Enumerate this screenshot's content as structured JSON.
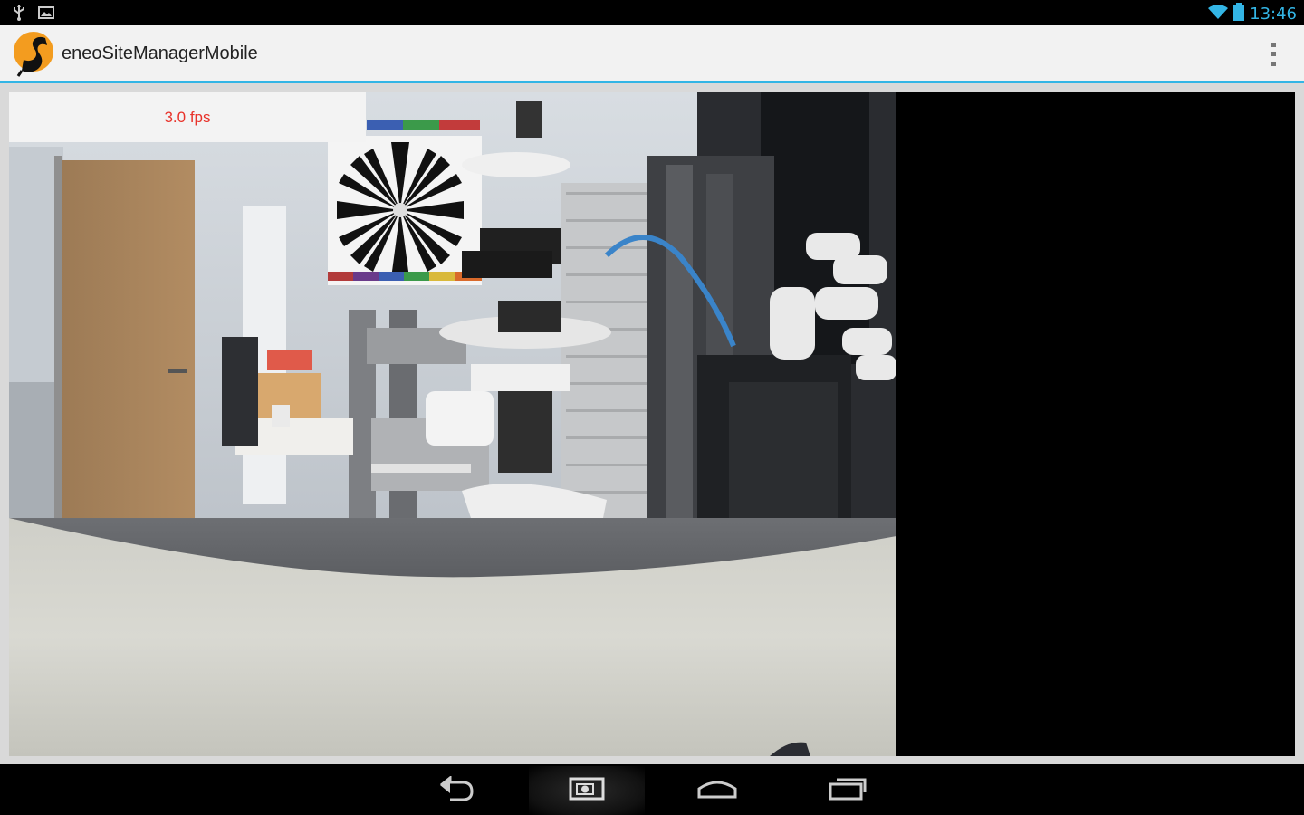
{
  "status_bar": {
    "time": "13:46",
    "icons": [
      "usb-icon",
      "image-notification-icon",
      "wifi-icon",
      "battery-icon"
    ]
  },
  "action_bar": {
    "app_title": "eneoSiteManagerMobile",
    "logo": "eneo-logo",
    "overflow_icon": "overflow-menu-icon"
  },
  "camera": {
    "fps_label": "3.0 fps"
  },
  "nav_bar": {
    "buttons": [
      "back-icon",
      "screenshot-icon",
      "home-icon",
      "recent-apps-icon"
    ]
  },
  "colors": {
    "accent": "#33b5e5",
    "fps_text": "#e8322a",
    "logo_orange": "#f39c1f"
  }
}
